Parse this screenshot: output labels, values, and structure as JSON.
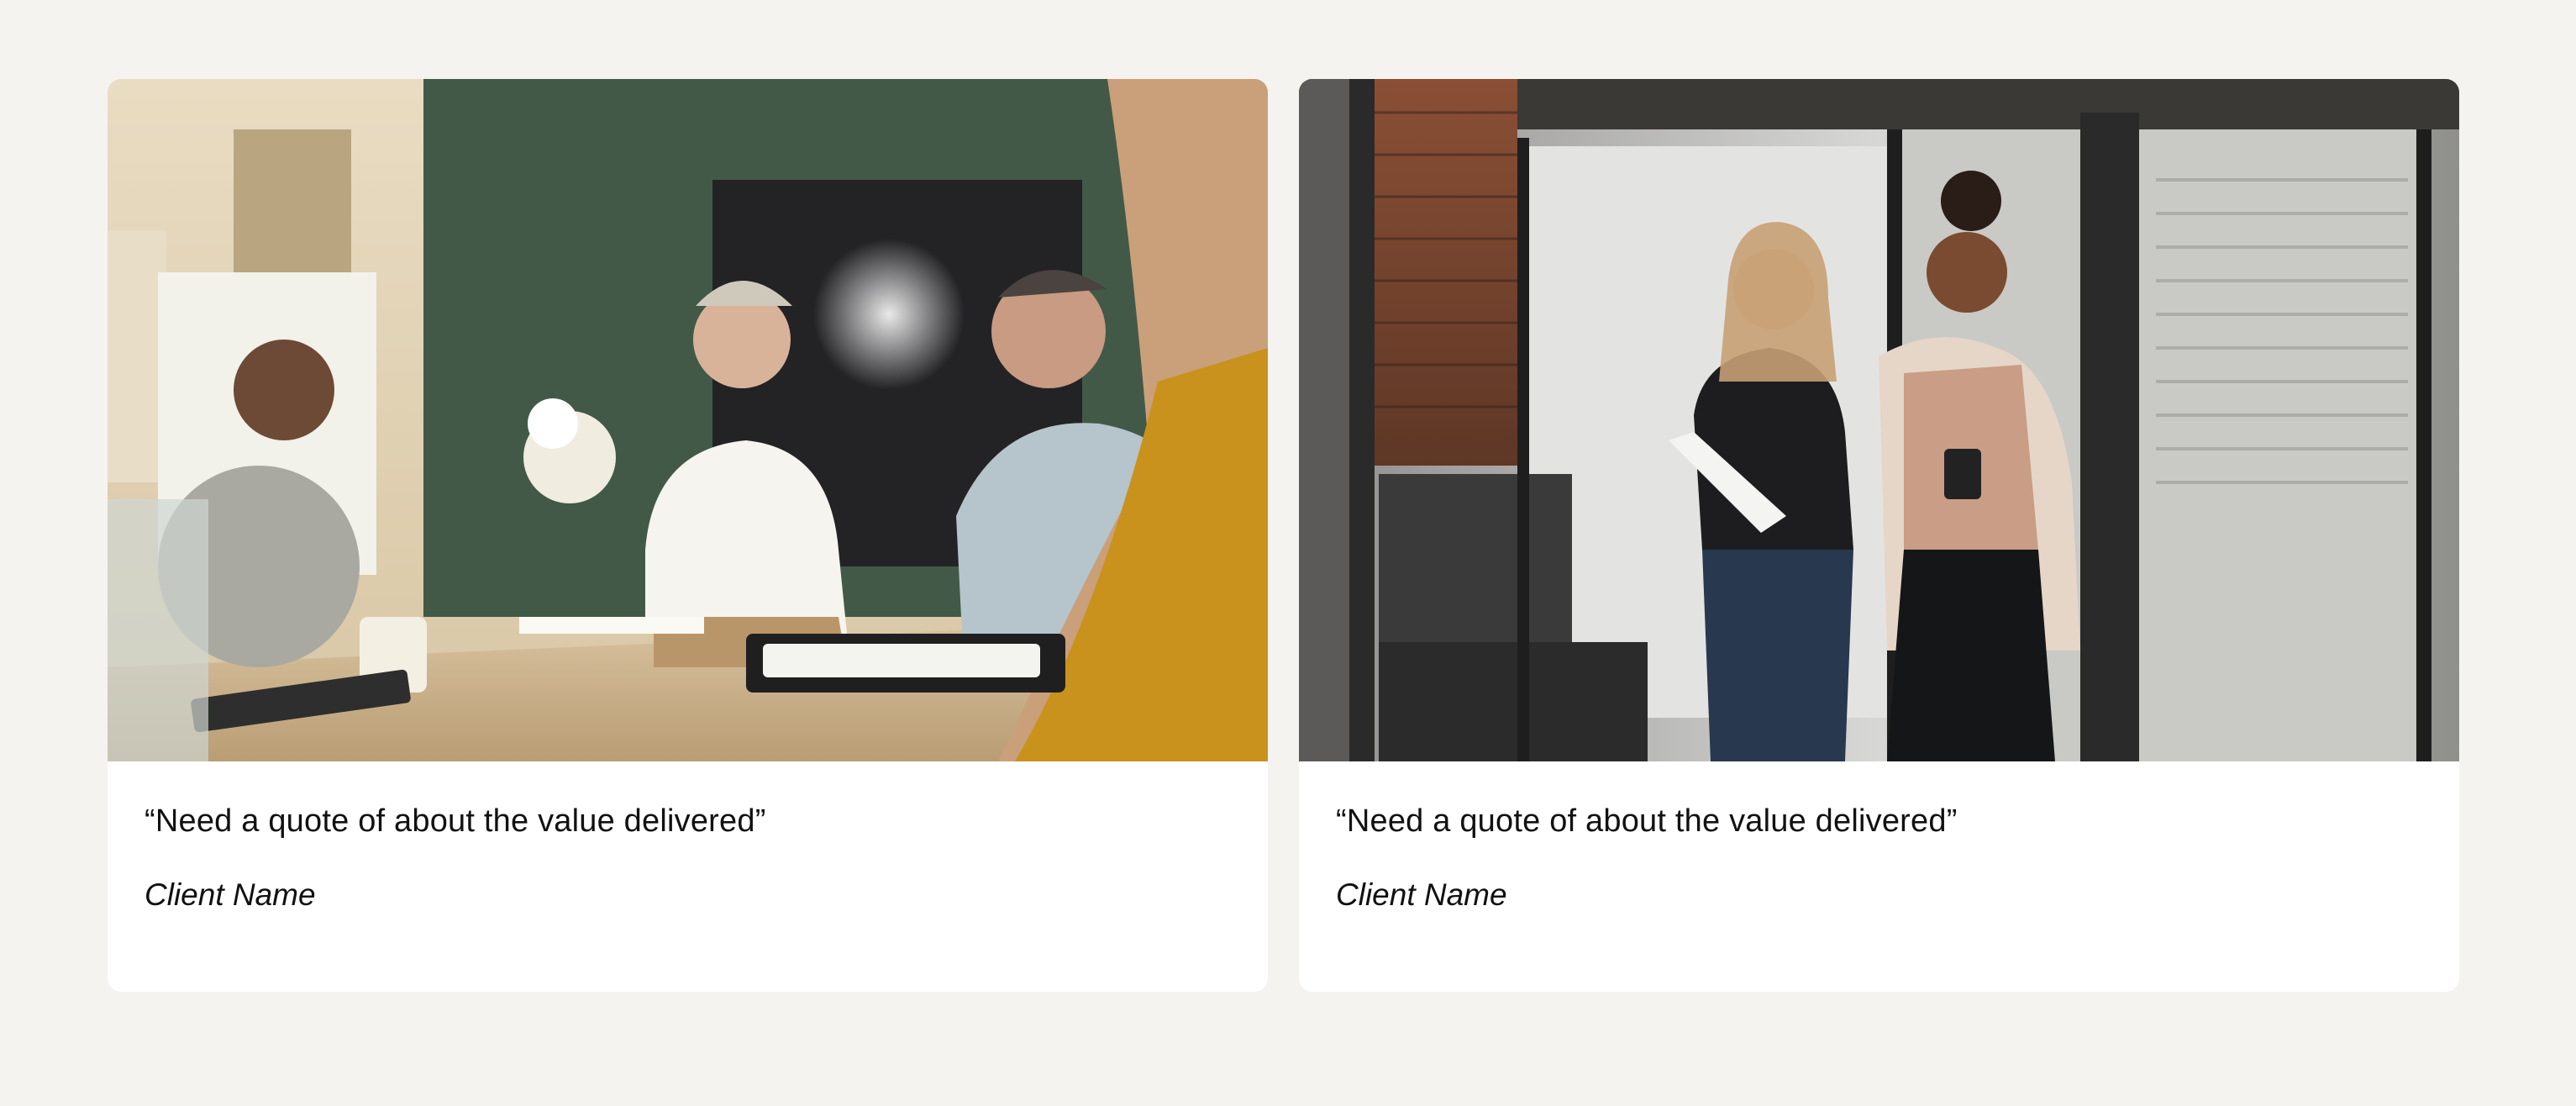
{
  "testimonials": [
    {
      "quote": "“Need a quote of about the value delivered”",
      "client_name": "Client Name"
    },
    {
      "quote": "“Need a quote of about the value delivered”",
      "client_name": "Client Name"
    }
  ]
}
